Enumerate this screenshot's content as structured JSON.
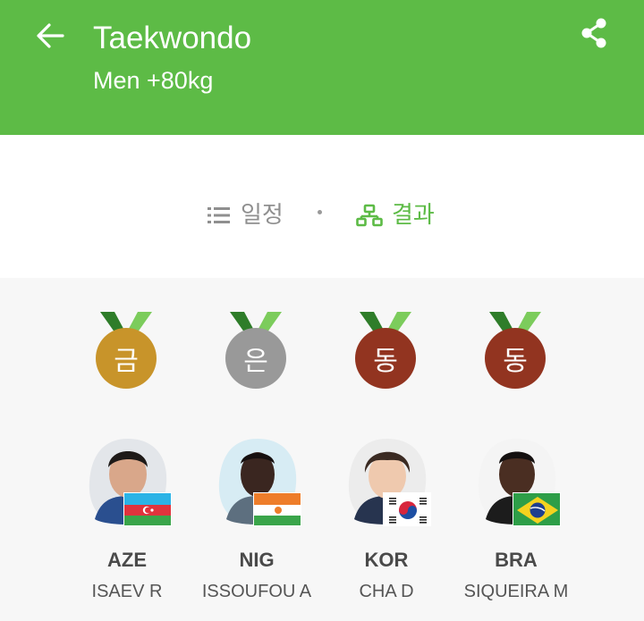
{
  "header": {
    "title": "Taekwondo",
    "subtitle": "Men +80kg",
    "back_icon": "arrow-left-icon",
    "share_icon": "share-icon",
    "background_color": "#5dbb46"
  },
  "tabs": [
    {
      "label": "일정",
      "icon": "list-icon",
      "active": false
    },
    {
      "label": "결과",
      "icon": "bracket-icon",
      "active": true
    }
  ],
  "medals": [
    {
      "label": "금",
      "color": "#c8942a"
    },
    {
      "label": "은",
      "color": "#999999"
    },
    {
      "label": "동",
      "color": "#923420"
    },
    {
      "label": "동",
      "color": "#923420"
    }
  ],
  "athletes": [
    {
      "code": "AZE",
      "name": "ISAEV R",
      "flag": "azerbaijan-flag"
    },
    {
      "code": "NIG",
      "name": "ISSOUFOU A",
      "flag": "niger-flag"
    },
    {
      "code": "KOR",
      "name": "CHA D",
      "flag": "korea-flag"
    },
    {
      "code": "BRA",
      "name": "SIQUEIRA M",
      "flag": "brazil-flag"
    }
  ]
}
